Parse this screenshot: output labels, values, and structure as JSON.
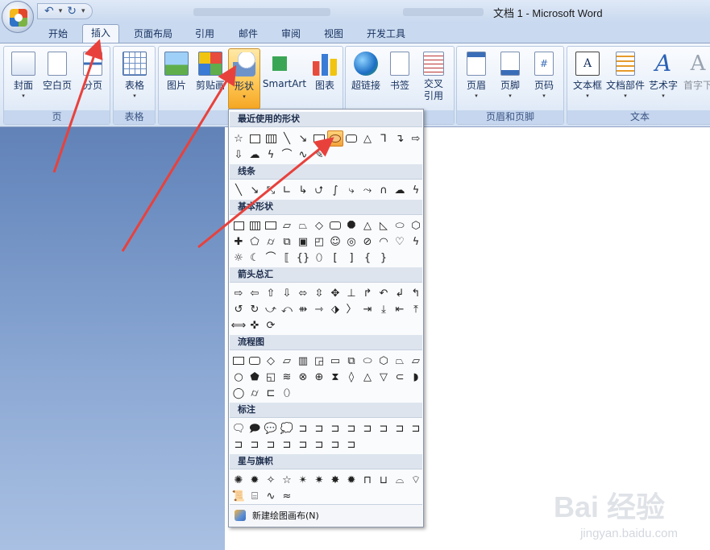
{
  "window": {
    "title": "文档 1 - Microsoft Word"
  },
  "qat": {
    "undo_icon": "↶",
    "redo_icon": "↻",
    "more": "▾"
  },
  "tabs": [
    {
      "label": "开始"
    },
    {
      "label": "插入"
    },
    {
      "label": "页面布局"
    },
    {
      "label": "引用"
    },
    {
      "label": "邮件"
    },
    {
      "label": "审阅"
    },
    {
      "label": "视图"
    },
    {
      "label": "开发工具"
    }
  ],
  "active_tab": "插入",
  "ribbon": {
    "groups": {
      "page": "页",
      "table": "表格",
      "links": "",
      "header_footer": "页眉和页脚",
      "text": "文本"
    },
    "buttons": {
      "cover": "封面",
      "blank": "空白页",
      "break": "分页",
      "table": "表格",
      "picture": "图片",
      "clipart": "剪贴画",
      "shapes": "形状",
      "smartart": "SmartArt",
      "chart": "图表",
      "hyperlink": "超链接",
      "bookmark": "书签",
      "crossref": "交叉\n引用",
      "header": "页眉",
      "footer": "页脚",
      "pagenum": "页码",
      "textbox": "文本框",
      "quickparts": "文档部件",
      "wordart": "艺术字",
      "dropcap": "首字下"
    }
  },
  "shapes_menu": {
    "sections": {
      "recent": "最近使用的形状",
      "lines": "线条",
      "basic": "基本形状",
      "arrows": "箭头总汇",
      "flowchart": "流程图",
      "callouts": "标注",
      "stars": "星与旗帜"
    },
    "new_canvas": "新建绘图画布(N)"
  },
  "watermark": {
    "main": "Bai 经验",
    "sub": "jingyan.baidu.com"
  },
  "colors": {
    "accent": "#f5a623",
    "arrow": "#e8413c",
    "ribbon_bg": "#e3ecf8"
  }
}
